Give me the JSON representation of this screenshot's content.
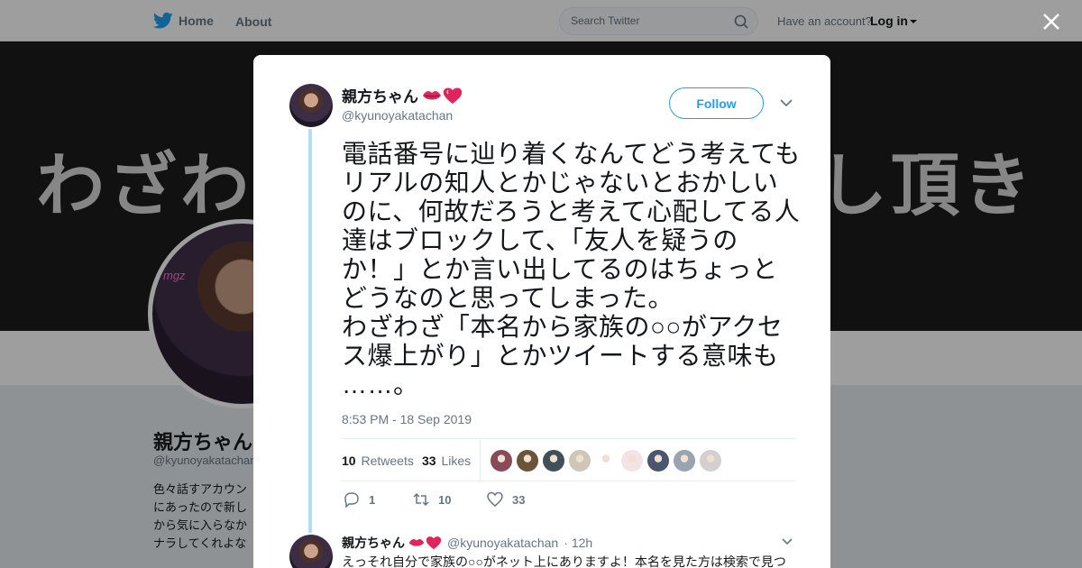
{
  "nav": {
    "home_label": "Home",
    "about_label": "About",
    "search_placeholder": "Search Twitter",
    "have_account": "Have an account?",
    "login_label": "Log in"
  },
  "background_profile": {
    "banner_left": "わざわ",
    "banner_right": "し頂き",
    "avatar_sign": "mgz",
    "name": "親方ちゃん",
    "handle": "@kyunoyakatachan",
    "bio_lines": [
      "色々話すアカウン",
      "にあったので新し",
      "から気に入らなか",
      "ナラしてくれよな"
    ]
  },
  "tweet": {
    "author_name": "親方ちゃん",
    "author_handle": "@kyunoyakatachan",
    "follow_label": "Follow",
    "text_lines": [
      "電話番号に辿り着くなんてどう考えても",
      "リアルの知人とかじゃないとおかしい",
      "のに、何故だろうと考えて心配してる人",
      "達はブロックして、「友人を疑うの",
      "か！」とか言い出してるのはちょっと",
      "どうなのと思ってしまった。",
      "わざわざ「本名から家族の○○がアクセ",
      "ス爆上がり」とかツイートする意味も",
      "……。"
    ],
    "timestamp": "8:53 PM - 18 Sep 2019",
    "retweets_count": "10",
    "retweets_label": "Retweets",
    "likes_count": "33",
    "likes_label": "Likes",
    "liker_colors": [
      "#8a4a5a",
      "#6b5438",
      "#40505a",
      "#cfc6b8",
      "#ffffff",
      "#f3e3e6",
      "#4a5570",
      "#9aa4b0",
      "#d6cfcf"
    ],
    "reply_count": "1",
    "retweet_action_count": "10",
    "like_action_count": "33"
  },
  "reply": {
    "author_name": "親方ちゃん",
    "author_handle": "@kyunoyakatachan",
    "time": "12h",
    "text": "えっそれ自分で家族の○○がネット上にありますよ！本名を見た方は検索で見つ"
  },
  "colors": {
    "accent": "#1da1f2",
    "muted": "#657786",
    "thread_line": "#b5dcf7"
  }
}
